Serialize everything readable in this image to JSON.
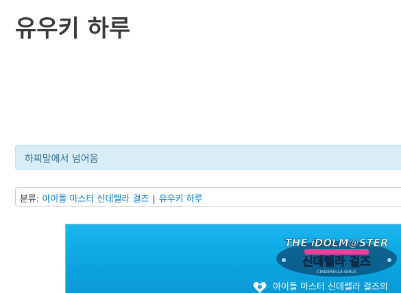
{
  "page": {
    "title": "유우키 하루"
  },
  "redirect": {
    "text": "하찌말에서 넘어옴"
  },
  "categories": {
    "label": "분류",
    "colon": ":",
    "items": [
      "아이돌 마스터 신데렐라 걸즈",
      "유우키 하루"
    ],
    "separator": "|"
  },
  "banner": {
    "logo_top_text": "THE iDOLM@STER",
    "logo_main_text": "신데렐라 걸즈",
    "logo_sub_text": "CINDERELLA GIRLS",
    "caption": "아이돌 마스터 신데렐라 걸즈의"
  },
  "colors": {
    "title": "#373a3c",
    "redirect_bg": "#d9edf7",
    "redirect_text": "#31708f",
    "link": "#0275d8",
    "banner_blue": "#0aa3df"
  }
}
